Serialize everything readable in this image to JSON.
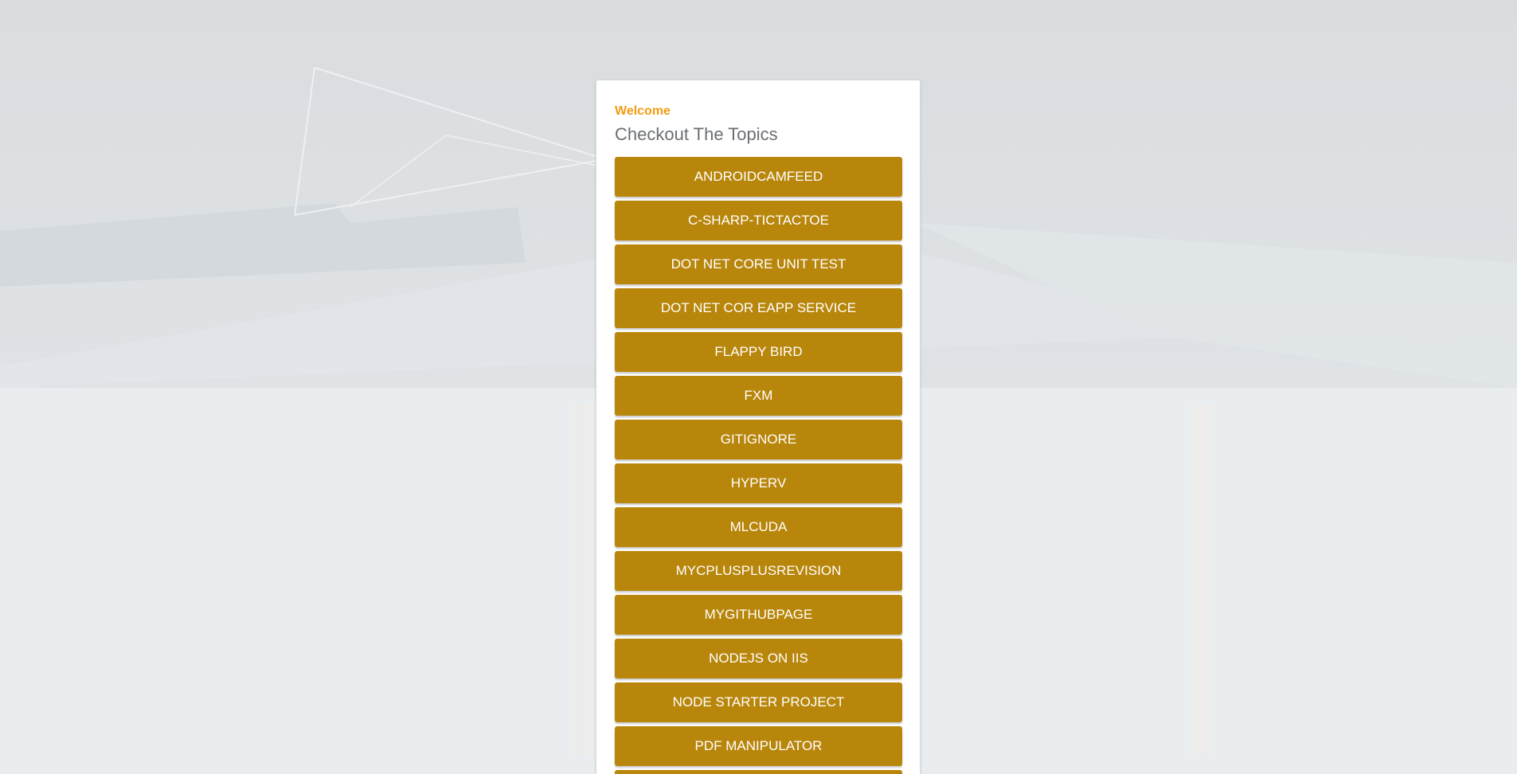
{
  "welcome_label": "Welcome",
  "page_title": "Checkout The Topics",
  "colors": {
    "accent": "#f39c12",
    "button_bg": "#b8860b",
    "button_text": "#ffffff",
    "title_text": "#6b6f73"
  },
  "topics": [
    "ANDROIDCAMFEED",
    "C-SHARP-TICTACTOE",
    "DOT NET CORE UNIT TEST",
    "DOT NET COR EAPP SERVICE",
    "FLAPPY BIRD",
    "FXM",
    "GITIGNORE",
    "HYPERV",
    "MLCUDA",
    "MYCPLUSPLUSREVISION",
    "MYGITHUBPAGE",
    "NODEJS ON IIS",
    "NODE STARTER PROJECT",
    "PDF MANIPULATOR",
    ""
  ]
}
